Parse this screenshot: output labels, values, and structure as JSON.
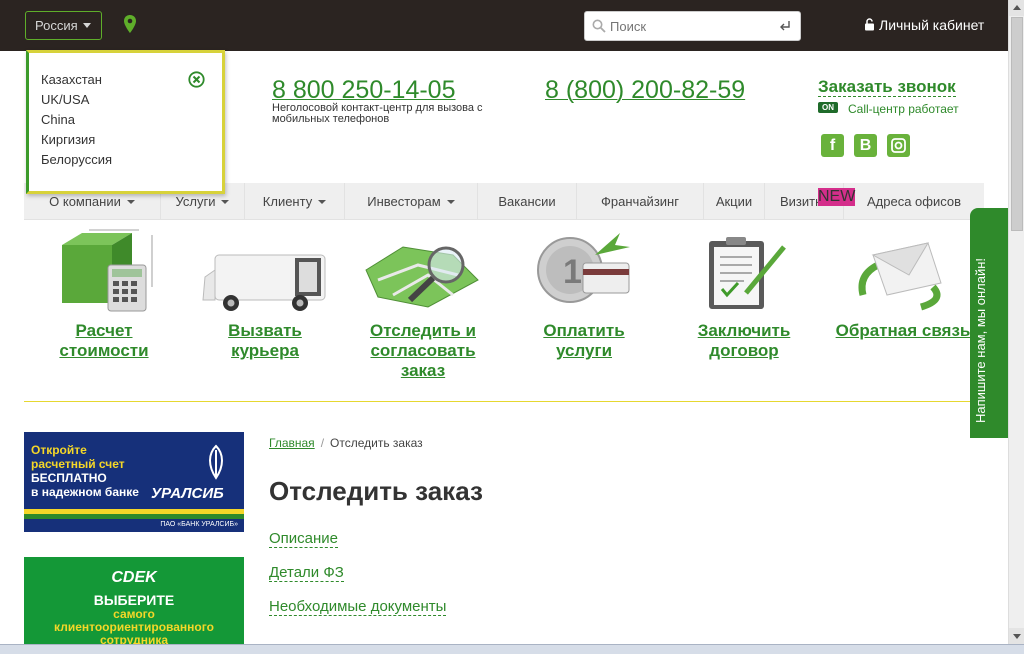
{
  "topbar": {
    "country_label": "Россия",
    "search_placeholder": "Поиск",
    "cabinet_label": "Личный кабинет"
  },
  "country_dropdown": {
    "items": [
      "Казахстан",
      "UK/USA",
      "China",
      "Киргизия",
      "Белоруссия"
    ]
  },
  "contacts": {
    "phone1": "8 800 250-14-05",
    "phone1_note": "Неголосовой контакт-центр для вызова с мобильных телефонов",
    "phone2": "8 (800) 200-82-59",
    "callback_label": "Заказать звонок",
    "on_badge": "ON",
    "callcenter_status": "Call-центр работает",
    "social": [
      "f",
      "B",
      "ig"
    ]
  },
  "nav": {
    "items": [
      "О компании",
      "Услуги",
      "Клиенту",
      "Инвесторам",
      "Вакансии",
      "Франчайзинг",
      "Акции",
      "Визитки",
      "Адреса офисов"
    ],
    "new_badge": "NEW"
  },
  "services": {
    "items": [
      {
        "label": "Расчет стоимости",
        "icon": "box-calculator-icon"
      },
      {
        "label": "Вызвать курьера",
        "icon": "van-icon"
      },
      {
        "label": "Отследить и согласовать заказ",
        "icon": "map-magnifier-icon"
      },
      {
        "label": "Оплатить услуги",
        "icon": "coin-card-icon"
      },
      {
        "label": "Заключить договор",
        "icon": "clipboard-pen-icon"
      },
      {
        "label": "Обратная связь",
        "icon": "envelope-icon"
      }
    ]
  },
  "chat_tab": "Напишите нам, мы онлайн!",
  "banner_uralsib": {
    "line1": "Откройте",
    "line2": "расчетный счет",
    "line3": "БЕСПЛАТНО",
    "line4": "в надежном банке",
    "brand": "УРАЛСИБ",
    "small": "ПАО «БАНК УРАЛСИБ»"
  },
  "banner_cdek": {
    "logo": "CDEK",
    "line1": "ВЫБЕРИТЕ",
    "line2": "самого",
    "line3": "клиентоориентированного",
    "line4": "сотрудника"
  },
  "breadcrumb": {
    "home": "Главная",
    "sep": "/",
    "current": "Отследить заказ"
  },
  "main": {
    "title": "Отследить заказ",
    "links": [
      "Описание",
      "Детали ФЗ",
      "Необходимые документы"
    ]
  },
  "colors": {
    "brand_green": "#2f8a2b",
    "topbar": "#2b2421",
    "accent_yellow": "#e6d830"
  }
}
